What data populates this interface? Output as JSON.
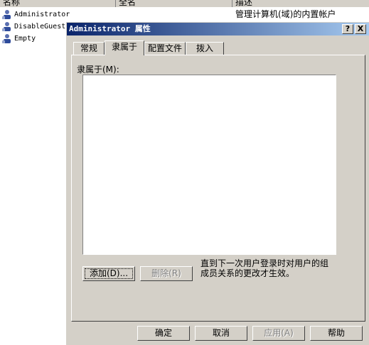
{
  "list": {
    "columns": [
      "名称",
      "全名",
      "描述"
    ],
    "rows": [
      {
        "name": "Administrator",
        "description": "管理计算机(域)的内置帐户",
        "icon": "user-icon"
      },
      {
        "name": "DisableGuest",
        "description": "",
        "icon": "user-icon"
      },
      {
        "name": "Empty",
        "description": "",
        "icon": "user-icon"
      }
    ]
  },
  "dialog": {
    "title": "Administrator 属性",
    "help_glyph": "?",
    "close_glyph": "X",
    "tabs": [
      "常规",
      "隶属于",
      "配置文件",
      "拨入"
    ],
    "active_tab": "隶属于",
    "member_of_label": "隶属于(M):",
    "member_of_items": [],
    "note": "直到下一次用户登录时对用户的组成员关系的更改才生效。",
    "buttons": {
      "add": "添加(D)...",
      "remove": "删除(R)",
      "ok": "确定",
      "cancel": "取消",
      "apply": "应用(A)",
      "help": "帮助"
    }
  },
  "colors": {
    "title_start": "#0a246a",
    "title_end": "#a6caf0",
    "face": "#d4d0c8"
  }
}
